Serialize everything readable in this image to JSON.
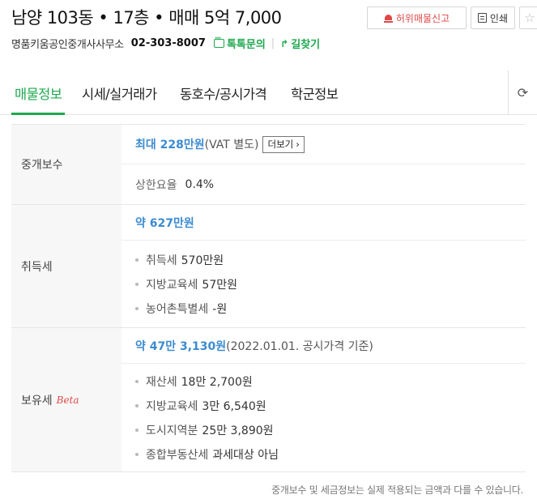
{
  "header": {
    "title": "남양 103동 • 17층 • 매매 5억 7,000",
    "report_label": "허위매물신고",
    "print_label": "인쇄",
    "office_name": "명품키움공인중개사사무소",
    "phone": "02-303-8007",
    "talk_label": "톡톡문의",
    "route_label": "길찾기"
  },
  "tabs": [
    {
      "label": "매물정보",
      "active": true
    },
    {
      "label": "시세/실거래가"
    },
    {
      "label": "동호수/공시가격"
    },
    {
      "label": "학군정보"
    }
  ],
  "brokerage": {
    "label": "중개보수",
    "max_amount": "최대 228만원",
    "vat_note": "(VAT 별도)",
    "more_label": "더보기",
    "rate_label": "상한요율",
    "rate_value": "0.4%"
  },
  "acquisition_tax": {
    "label": "취득세",
    "total": "약 627만원",
    "items": [
      {
        "name": "취득세",
        "value": "570만원"
      },
      {
        "name": "지방교육세",
        "value": "57만원"
      },
      {
        "name": "농어촌특별세",
        "value": "-원"
      }
    ]
  },
  "holding_tax": {
    "label": "보유세",
    "beta": "Beta",
    "total": "약 47만 3,130원",
    "basis": "(2022.01.01. 공시가격 기준)",
    "items": [
      {
        "name": "재산세",
        "value": "18만 2,700원"
      },
      {
        "name": "지방교육세",
        "value": "3만 6,540원"
      },
      {
        "name": "도시지역분",
        "value": "25만 3,890원"
      },
      {
        "name": "종합부동산세",
        "value": "과세대상 아님"
      }
    ]
  },
  "footnote": "중개보수 및 세금정보는 실제 적용되는 금액과 다를 수 있습니다.",
  "colors": {
    "accent": "#1fa84f",
    "value_blue": "#3c8bd0",
    "report_red": "#e04848"
  }
}
